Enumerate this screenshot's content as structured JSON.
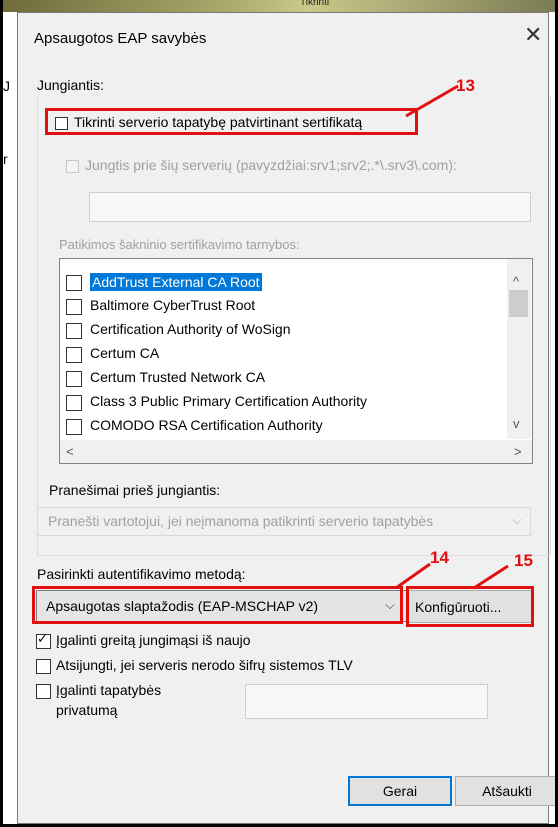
{
  "background_window": {
    "tab_text": "Tikrinti",
    "label_j": "J",
    "label_r": "r"
  },
  "dialog": {
    "title": "Apsaugotos EAP savybės",
    "close_glyph": "✕",
    "connecting_label": "Jungiantis:",
    "verify_server_label": "Tikrinti serverio tapatybę patvirtinant sertifikatą",
    "verify_server_checked": false,
    "connect_servers_label": "Jungtis prie šių serverių (pavyzdžiai:srv1;srv2;.*\\.srv3\\.com):",
    "servers_value": "",
    "trusted_ca_label": "Patikimos šakninio sertifikavimo tarnybos:",
    "ca_list": [
      {
        "label": "AddTrust External CA Root",
        "checked": false,
        "selected": true
      },
      {
        "label": "Baltimore CyberTrust Root",
        "checked": false,
        "selected": false
      },
      {
        "label": "Certification Authority of WoSign",
        "checked": false,
        "selected": false
      },
      {
        "label": "Certum CA",
        "checked": false,
        "selected": false
      },
      {
        "label": "Certum Trusted Network CA",
        "checked": false,
        "selected": false
      },
      {
        "label": "Class 3 Public Primary Certification Authority",
        "checked": false,
        "selected": false
      },
      {
        "label": "COMODO RSA Certification Authority",
        "checked": false,
        "selected": false
      }
    ],
    "notifications_label": "Pranešimai prieš jungiantis:",
    "notifications_value": "Pranešti vartotojui, jei neįmanoma patikrinti serverio tapatybės",
    "auth_method_label": "Pasirinkti autentifikavimo metodą:",
    "auth_method_value": "Apsaugotas slaptažodis (EAP-MSCHAP v2)",
    "configure_button": "Konfigūruoti...",
    "fast_reconnect_label": "Įgalinti greitą jungimąsi iš naujo",
    "fast_reconnect_checked": true,
    "disconnect_tlv_label": "Atsijungti, jei serveris nerodo šifrų sistemos TLV",
    "disconnect_tlv_checked": false,
    "identity_privacy_line1": "Įgalinti tapatybės",
    "identity_privacy_line2": "privatumą",
    "identity_privacy_checked": false,
    "identity_value": "",
    "ok_button": "Gerai",
    "cancel_button": "Atšaukti"
  },
  "annotations": {
    "n13": "13",
    "n14": "14",
    "n15": "15",
    "color": "#e01010"
  },
  "icons": {
    "scroll_up": "^",
    "scroll_down": "v",
    "scroll_left": "<",
    "scroll_right": ">",
    "combo_arrow": "⌵"
  }
}
